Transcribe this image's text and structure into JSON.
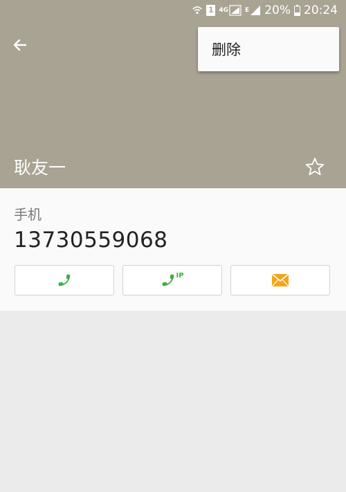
{
  "status_bar": {
    "sim_badge": "1",
    "network_type_1": "4G",
    "network_type_2": "E",
    "battery": "20%",
    "time": "20:24"
  },
  "menu": {
    "delete_label": "删除"
  },
  "contact": {
    "name": "耿友一",
    "phone_label": "手机",
    "phone_number": "13730559068"
  },
  "actions": {
    "ip_call_badge": "IP"
  },
  "colors": {
    "header": "#a9a393",
    "call_green": "#3fae3f",
    "message_orange": "#f0a71c",
    "background": "#ebebeb"
  }
}
